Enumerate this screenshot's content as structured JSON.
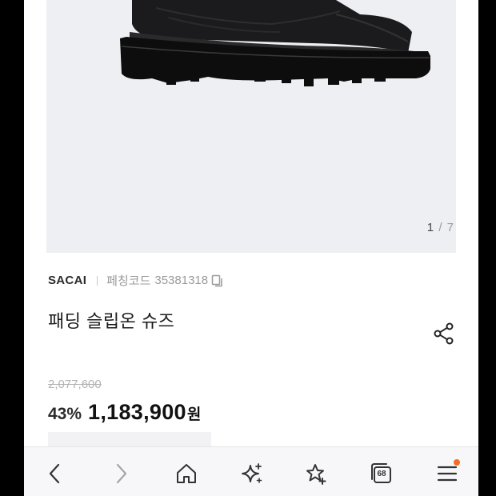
{
  "gallery": {
    "current": "1",
    "separator": "/",
    "total": "7",
    "background": "#eeeff3"
  },
  "product": {
    "brand": "SACAI",
    "code_label": "페칭코드",
    "code": "35381318",
    "title": "패딩 슬립온 슈즈",
    "original_price": "2,077,600",
    "discount": "43%",
    "price": "1,183,900",
    "currency": "원"
  },
  "toolbar": {
    "items": [
      "back-icon",
      "forward-icon",
      "home-icon",
      "sparkle-icon",
      "add-bookmark-icon",
      "tabs-icon",
      "menu-icon"
    ],
    "tab_count": "68",
    "notification_color": "#f36d24"
  }
}
